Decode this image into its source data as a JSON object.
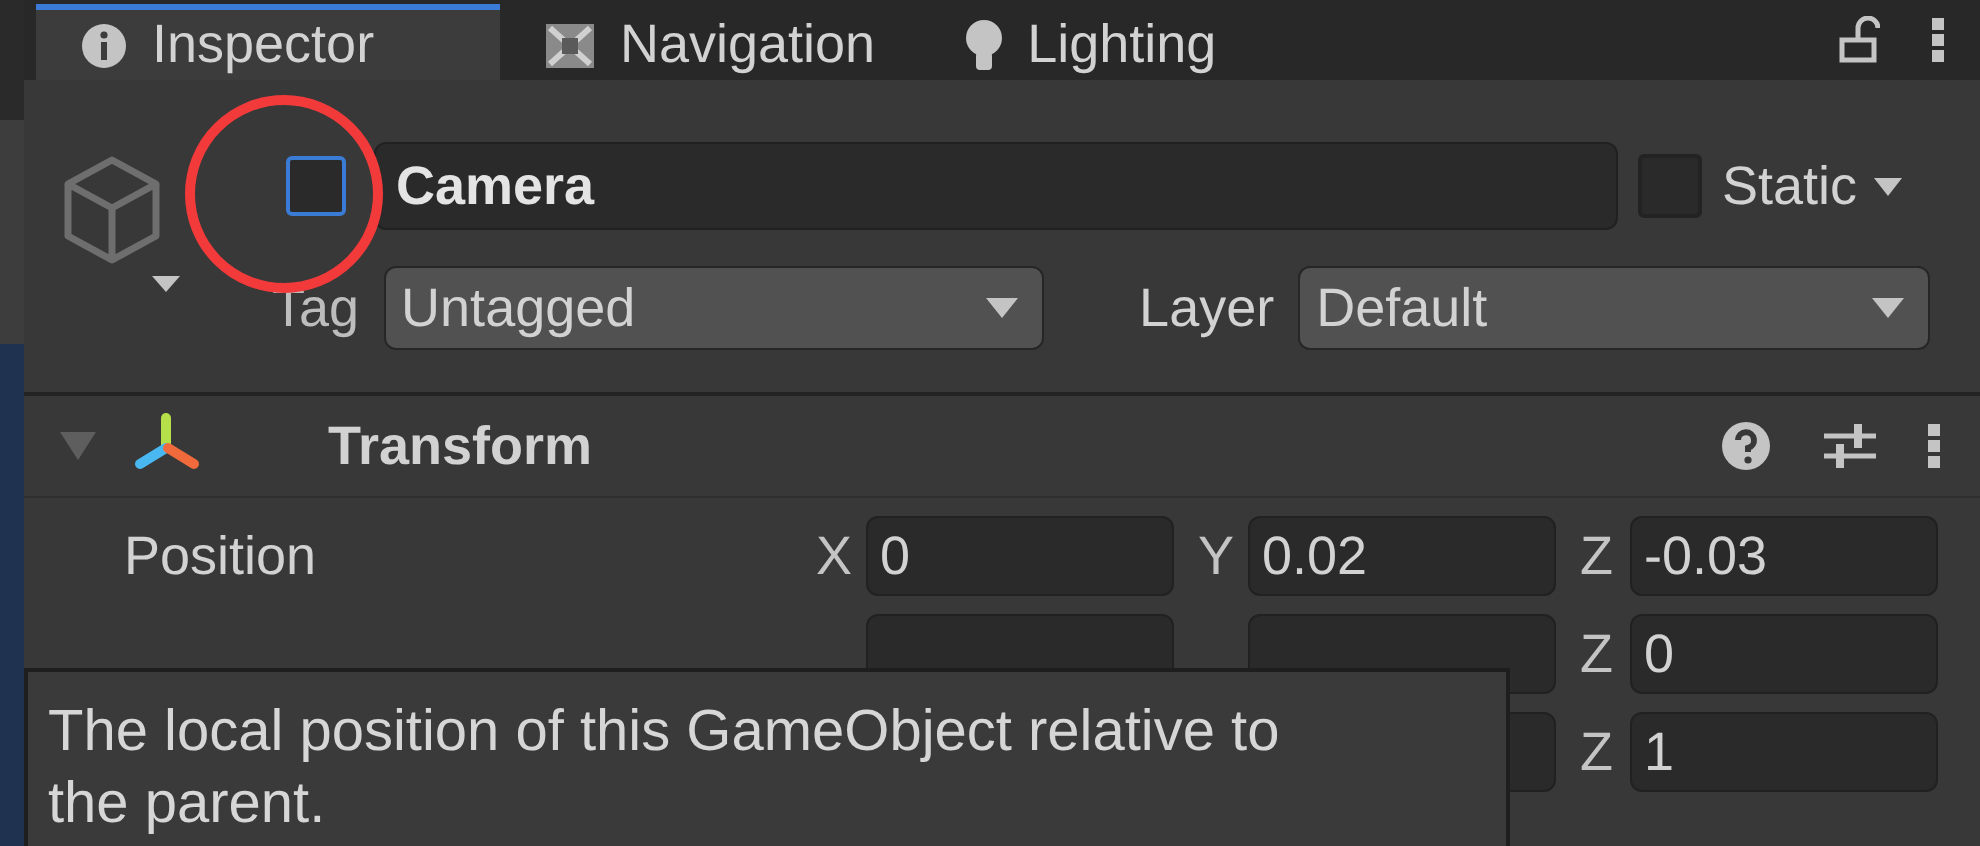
{
  "tabs": [
    {
      "label": "Inspector",
      "selected": true
    },
    {
      "label": "Navigation",
      "selected": false
    },
    {
      "label": "Lighting",
      "selected": false
    }
  ],
  "object": {
    "active": false,
    "name": "Camera",
    "static": false,
    "static_label": "Static",
    "tag_label": "Tag",
    "tag": "Untagged",
    "layer_label": "Layer",
    "layer": "Default"
  },
  "component": {
    "title": "Transform",
    "expanded": true,
    "rows": [
      {
        "label": "Position",
        "fields": [
          {
            "axis": "X",
            "value": "0"
          },
          {
            "axis": "Y",
            "value": "0.02"
          },
          {
            "axis": "Z",
            "value": "-0.03"
          }
        ]
      },
      {
        "fields": [
          {
            "axis": "Z",
            "value": "0"
          }
        ]
      },
      {
        "fields": [
          {
            "axis": "Z",
            "value": "1"
          }
        ]
      }
    ]
  },
  "tooltip": "The local position of this GameObject relative to the parent."
}
